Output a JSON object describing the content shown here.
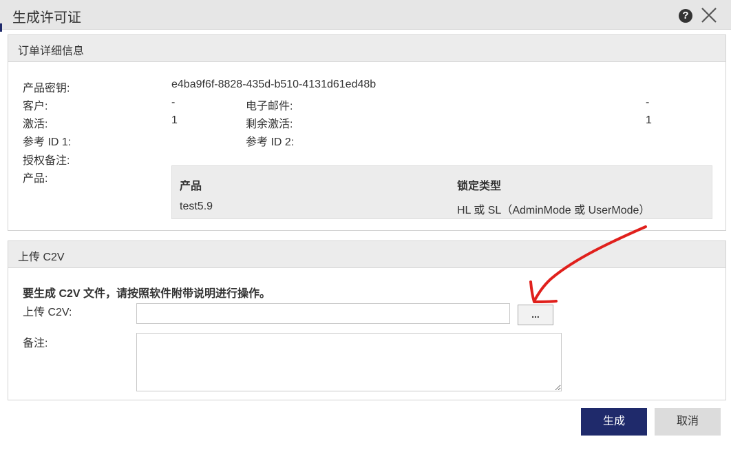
{
  "dialog": {
    "title": "生成许可证"
  },
  "order_details": {
    "header": "订单详细信息",
    "product_key_label": "产品密钥:",
    "product_key_value": "e4ba9f6f-8828-435d-b510-4131d61ed48b",
    "customer_label": "客户:",
    "customer_value": "-",
    "email_label": "电子邮件:",
    "email_value": "-",
    "activations_label": "激活:",
    "activations_value": "1",
    "remaining_label": "剩余激活:",
    "remaining_value": "1",
    "ref1_label": "参考 ID 1:",
    "ref2_label": "参考 ID 2:",
    "auth_notes_label": "授权备注:",
    "products_label": "产品:",
    "products_table": {
      "headers": [
        "产品",
        "锁定类型"
      ],
      "rows": [
        [
          "test5.9",
          "HL 或 SL（AdminMode 或 UserMode）"
        ]
      ]
    }
  },
  "upload": {
    "header": "上传 C2V",
    "instruction": "要生成 C2V 文件，请按照软件附带说明进行操作。",
    "upload_label": "上传 C2V:",
    "file_value": "",
    "browse_label": "...",
    "notes_label": "备注:",
    "notes_value": ""
  },
  "footer": {
    "generate_label": "生成",
    "cancel_label": "取消"
  },
  "colors": {
    "primary": "#1f2a6b",
    "annotation": "#e0201c",
    "panel_header": "#ececec"
  }
}
